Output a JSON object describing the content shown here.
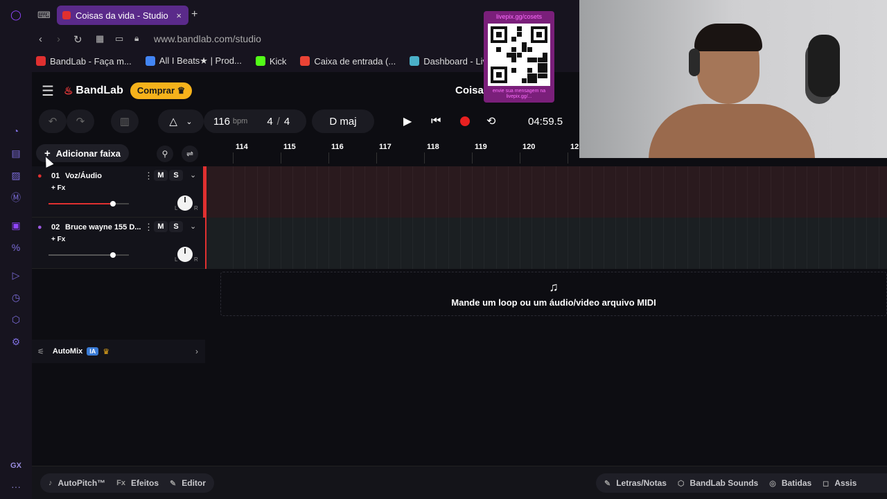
{
  "browser": {
    "tab_title": "Coisas da vida - Studio",
    "tab_close": "×",
    "new_tab": "+",
    "url_domain": "www.bandlab.com",
    "url_path": "/studio",
    "bookmarks": [
      {
        "label": "BandLab - Faça m...",
        "color": "#e03030"
      },
      {
        "label": "All I Beats★ | Prod...",
        "color": "#4285f4"
      },
      {
        "label": "Kick",
        "color": "#53fc18"
      },
      {
        "label": "Caixa de entrada (...",
        "color": "#ea4335"
      },
      {
        "label": "Dashboard - LiveP...",
        "color": "#4ab0c8"
      }
    ],
    "rail_gx": "GX",
    "rail_more": "···"
  },
  "app": {
    "logo": "BandLab",
    "buy_label": "Comprar",
    "project_title": "Coisas",
    "tempo_value": "116",
    "tempo_unit": "bpm",
    "time_sig_num": "4",
    "time_sig_sep": "/",
    "time_sig_den": "4",
    "key": "D maj",
    "time_display": "04:59.5",
    "add_track_label": "Adicionar faixa",
    "ruler_ticks": [
      "114",
      "115",
      "116",
      "117",
      "118",
      "119",
      "120",
      "12"
    ],
    "tracks": [
      {
        "num": "01",
        "name": "Voz/Áudio",
        "fx": "+ Fx",
        "mute": "M",
        "solo": "S",
        "volume": 0.8,
        "pan_l": "L",
        "pan_r": "R",
        "color": "#e03030",
        "active": true
      },
      {
        "num": "02",
        "name": "Bruce wayne 155 D...",
        "fx": "+ Fx",
        "mute": "M",
        "solo": "S",
        "volume": 0.8,
        "pan_l": "L",
        "pan_r": "R",
        "color": "#9b59e0",
        "active": false
      }
    ],
    "automix_label": "AutoMix",
    "automix_badge": "IA",
    "dropzone_text": "Mande um loop ou um áudio/video arquivo MIDI"
  },
  "bottom_bar": {
    "left": [
      {
        "label": "AutoPitch™",
        "icon": "♪"
      },
      {
        "label": "Efeitos",
        "icon": "Fx"
      },
      {
        "label": "Editor",
        "icon": "✎"
      }
    ],
    "right": [
      {
        "label": "Letras/Notas",
        "icon": "✎"
      },
      {
        "label": "BandLab Sounds",
        "icon": "⬡"
      },
      {
        "label": "Batidas",
        "icon": "◎"
      },
      {
        "label": "Assis",
        "icon": "◻"
      }
    ]
  },
  "overlay": {
    "qr_top_text": "livepix.gg/cosets",
    "qr_bottom_text": "envie sua mensagem na livepix.gg/..."
  },
  "colors": {
    "accent": "#f6b21b",
    "record": "#e82020",
    "tab": "#5a2a8a"
  }
}
